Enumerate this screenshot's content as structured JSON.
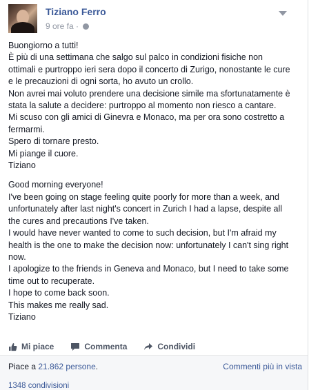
{
  "post": {
    "author": "Tiziano Ferro",
    "timestamp": "9 ore fa",
    "privacy_icon": "globe-icon",
    "menu_icon": "chevron-down-icon",
    "paragraphs": [
      [
        "Buongiorno a tutti!",
        "È più di una settimana che salgo sul palco in condizioni fisiche non",
        "ottimali e purtroppo ieri sera dopo il concerto di Zurigo, nonostante le cure",
        "e le precauzioni di ogni sorta, ho avuto un crollo.",
        "Non avrei mai voluto prendere una decisione simile ma sfortunatamente è",
        "stata la salute a decidere: purtroppo al momento non riesco a cantare.",
        "Mi scuso con gli amici di Ginevra e Monaco, ma per ora sono costretto a",
        "fermarmi.",
        "Spero di tornare presto.",
        "Mi piange il cuore.",
        "Tiziano"
      ],
      [
        "Good morning everyone!",
        "I've been going on stage feeling quite poorly for more than a week, and",
        "unfortunately after last night's concert in Zurich I had a lapse, despite all",
        "the cures and precautions I've taken.",
        "I would have never wanted to come to such decision, but I'm afraid my",
        "health is the one to make the decision now: unfortunately I can't sing right",
        "now.",
        "I apologize to the friends in Geneva and Monaco, but I need to take some",
        "time out to recuperate.",
        "I hope to come back soon.",
        "This makes me really sad.",
        "Tiziano"
      ]
    ]
  },
  "actions": {
    "like_label": "Mi piace",
    "comment_label": "Commenta",
    "share_label": "Condividi"
  },
  "stats": {
    "likes_prefix": "Piace a ",
    "likes_count": "21.862 persone",
    "likes_suffix": ".",
    "comments_link": "Commenti più in vista",
    "shares": "1348 condivisioni"
  },
  "colors": {
    "link": "#3b5998",
    "muted": "#9197a3",
    "action": "#4e5665"
  }
}
